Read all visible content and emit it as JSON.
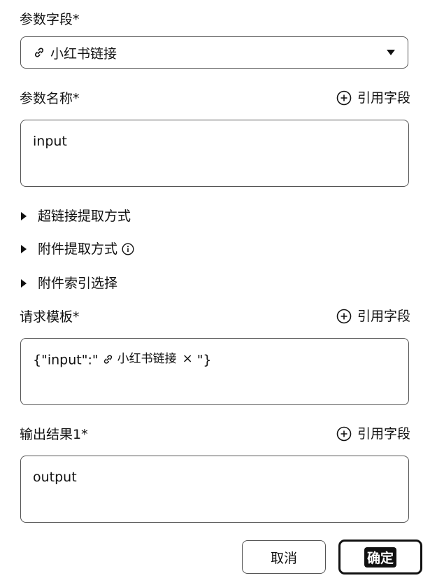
{
  "param_field": {
    "label": "参数字段*",
    "selected_value": "小红书链接",
    "icon": "link-icon"
  },
  "param_name": {
    "label": "参数名称*",
    "ref_label": "引用字段",
    "value": "input"
  },
  "toggles": [
    {
      "label": "超链接提取方式"
    },
    {
      "label": "附件提取方式"
    },
    {
      "label": "附件索引选择"
    }
  ],
  "request_template": {
    "label": "请求模板*",
    "ref_label": "引用字段",
    "prefix": "{\"input\":\"",
    "chip_label": "小红书链接",
    "chip_close": "×",
    "suffix": "\"}"
  },
  "output_result": {
    "label": "输出结果1*",
    "ref_label": "引用字段",
    "value": "output"
  },
  "buttons": {
    "cancel": "取消",
    "confirm": "确定"
  }
}
